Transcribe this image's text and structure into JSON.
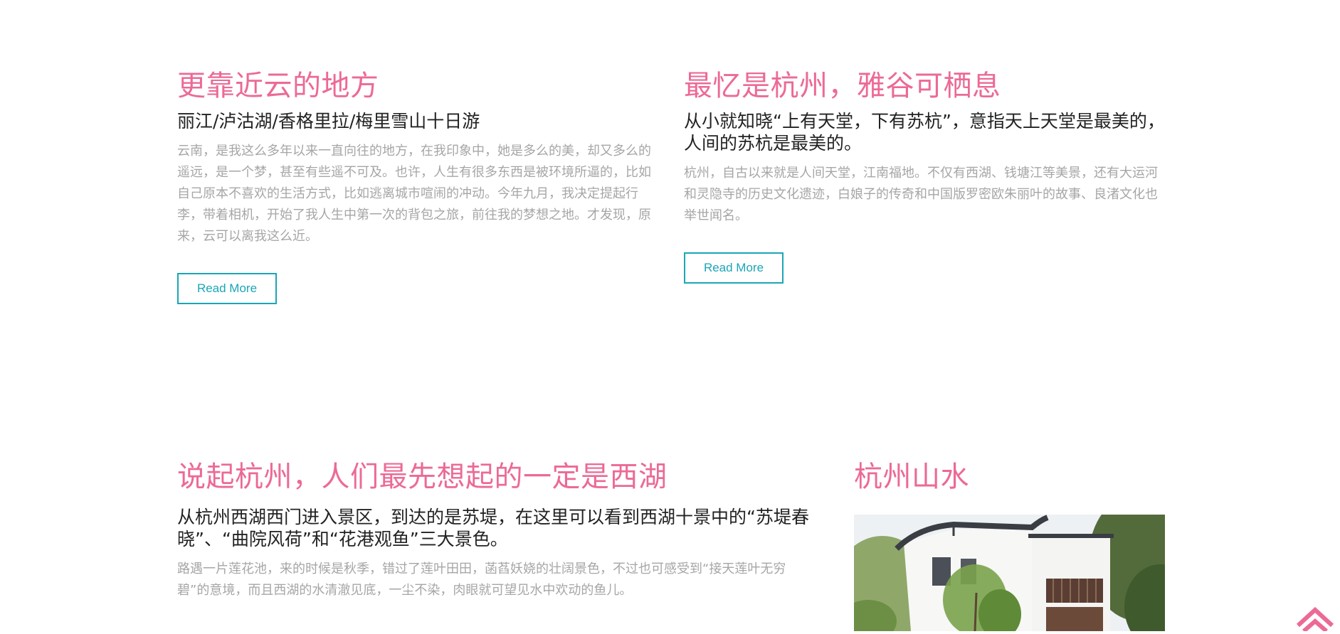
{
  "articles": [
    {
      "title": "更靠近云的地方",
      "subtitle": "丽江/泸沽湖/香格里拉/梅里雪山十日游",
      "description": "云南，是我这么多年以来一直向往的地方，在我印象中，她是多么的美，却又多么的遥远，是一个梦，甚至有些遥不可及。也许，人生有很多东西是被环境所逼的，比如自己原本不喜欢的生活方式，比如逃离城市喧闹的冲动。今年九月，我决定提起行李，带着相机，开始了我人生中第一次的背包之旅，前往我的梦想之地。才发现，原来，云可以离我这么近。",
      "button": "Read More"
    },
    {
      "title": "最忆是杭州，雅谷可栖息",
      "subtitle": "从小就知晓“上有天堂，下有苏杭”，意指天上天堂是最美的，人间的苏杭是最美的。",
      "description": "杭州，自古以来就是人间天堂，江南福地。不仅有西湖、钱塘江等美景，还有大运河和灵隐寺的历史文化遗迹，白娘子的传奇和中国版罗密欧朱丽叶的故事、良渚文化也举世闻名。",
      "button": "Read More"
    },
    {
      "title": "说起杭州，人们最先想起的一定是西湖",
      "subtitle": "从杭州西湖西门进入景区，到达的是苏堤，在这里可以看到西湖十景中的“苏堤春晓”、“曲院风荷”和“花港观鱼”三大景色。",
      "description": "路遇一片莲花池，来的时候是秋季，错过了莲叶田田，菡萏妖娆的壮阔景色，不过也可感受到“接天莲叶无穷碧”的意境，而且西湖的水清澈见底，一尘不染，肉眼就可望见水中欢动的鱼儿。"
    },
    {
      "title": "杭州山水"
    }
  ],
  "colors": {
    "title": "#ec6a95",
    "subtitle": "#222222",
    "description": "#a6a6a6",
    "button": "#1aa6b7",
    "scroll_top_icon": "#ec6a95"
  },
  "icons": {
    "scroll_top": "double-chevron-up-icon"
  }
}
